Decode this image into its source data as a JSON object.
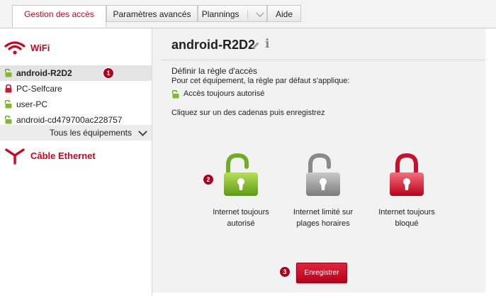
{
  "tabs": [
    {
      "label": "Gestion des accès"
    },
    {
      "label": "Paramètres avancés"
    },
    {
      "label": "Plannings"
    },
    {
      "label": "Aide"
    }
  ],
  "sidebar": {
    "wifi_label": "WiFi",
    "wifi_devices": [
      {
        "name": "android-R2D2",
        "lock": "green-open",
        "selected": true
      },
      {
        "name": "PC-Selfcare",
        "lock": "red-closed"
      },
      {
        "name": "user-PC",
        "lock": "green-open"
      },
      {
        "name": "android-cd479700ac228757",
        "lock": "green-open"
      }
    ],
    "all_devices_label": "Tous les équipements",
    "ethernet_label": "Câble Ethernet"
  },
  "main": {
    "device_title": "android-R2D2",
    "rule_heading": "Définir la règle d'accès",
    "rule_subtext": "Pour cet équipement, la règle par défaut s'applique:",
    "current_rule": "Accès toujours autorisé",
    "instruction": "Cliquez sur un des cadenas puis enregistrez",
    "choices": [
      {
        "line1": "Internet toujours",
        "line2": "autorisé",
        "color": "#7dbb2a"
      },
      {
        "line1": "Internet limité sur",
        "line2": "plages horaires",
        "color": "#9a9a9a"
      },
      {
        "line1": "Internet toujours",
        "line2": "bloqué",
        "color": "#d0182c"
      }
    ],
    "save_label": "Enregistrer"
  },
  "badges": {
    "step1": "1",
    "step2": "2",
    "step3": "3"
  },
  "colors": {
    "accent": "#d5001c",
    "allowed": "#7dbb2a",
    "limited": "#9a9a9a",
    "blocked": "#d0182c"
  }
}
